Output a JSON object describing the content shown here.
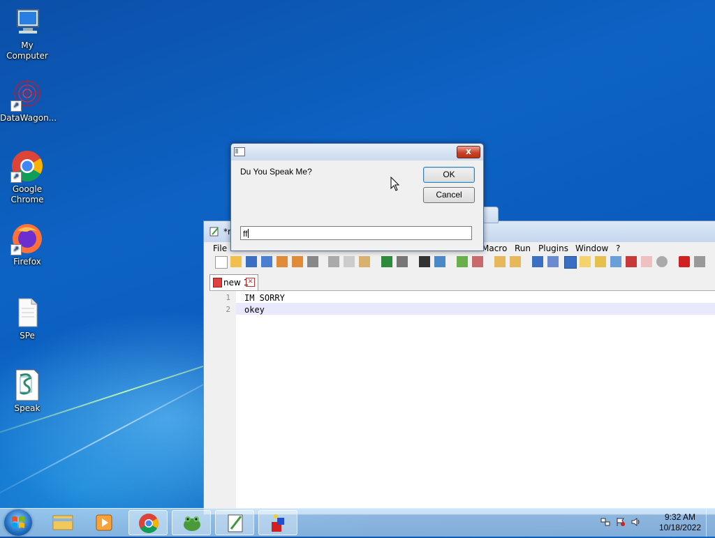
{
  "desktop": {
    "icons": [
      {
        "label": "My Computer"
      },
      {
        "label": "DataWagon..."
      },
      {
        "label": "Google Chrome"
      },
      {
        "label": "Firefox"
      },
      {
        "label": "SPe"
      },
      {
        "label": "Speak"
      }
    ]
  },
  "notepad": {
    "title_fragment": "*r",
    "menu": [
      "File",
      "Macro",
      "Run",
      "Plugins",
      "Window",
      "?"
    ],
    "tab_label": "new 1",
    "lines": [
      {
        "num": "1",
        "text": "IM SORRY"
      },
      {
        "num": "2",
        "text": "okey"
      }
    ]
  },
  "dialog": {
    "prompt": "Du You Speak Me?",
    "ok_label": "OK",
    "cancel_label": "Cancel",
    "close_glyph": "x",
    "input_value": "ff"
  },
  "taskbar": {
    "time": "9:32 AM",
    "date": "10/18/2022"
  }
}
